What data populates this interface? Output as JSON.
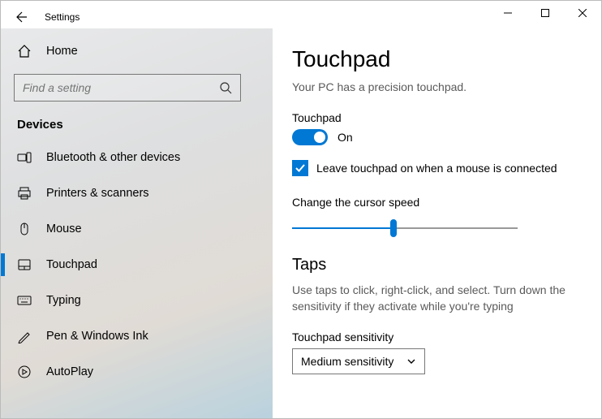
{
  "window": {
    "title": "Settings"
  },
  "sidebar": {
    "home_label": "Home",
    "search_placeholder": "Find a setting",
    "section": "Devices",
    "items": [
      {
        "label": "Bluetooth & other devices",
        "icon": "bluetooth-devices-icon"
      },
      {
        "label": "Printers & scanners",
        "icon": "printer-icon"
      },
      {
        "label": "Mouse",
        "icon": "mouse-icon"
      },
      {
        "label": "Touchpad",
        "icon": "touchpad-icon",
        "active": true
      },
      {
        "label": "Typing",
        "icon": "keyboard-icon"
      },
      {
        "label": "Pen & Windows Ink",
        "icon": "pen-icon"
      },
      {
        "label": "AutoPlay",
        "icon": "autoplay-icon"
      }
    ]
  },
  "content": {
    "heading": "Touchpad",
    "subtitle": "Your PC has a precision touchpad.",
    "touchpad_label": "Touchpad",
    "toggle_state": "On",
    "checkbox_label": "Leave touchpad on when a mouse is connected",
    "cursor_speed_label": "Change the cursor speed",
    "taps_heading": "Taps",
    "taps_desc": "Use taps to click, right-click, and select. Turn down the sensitivity if they activate while you're typing",
    "sensitivity_label": "Touchpad sensitivity",
    "sensitivity_value": "Medium sensitivity"
  }
}
